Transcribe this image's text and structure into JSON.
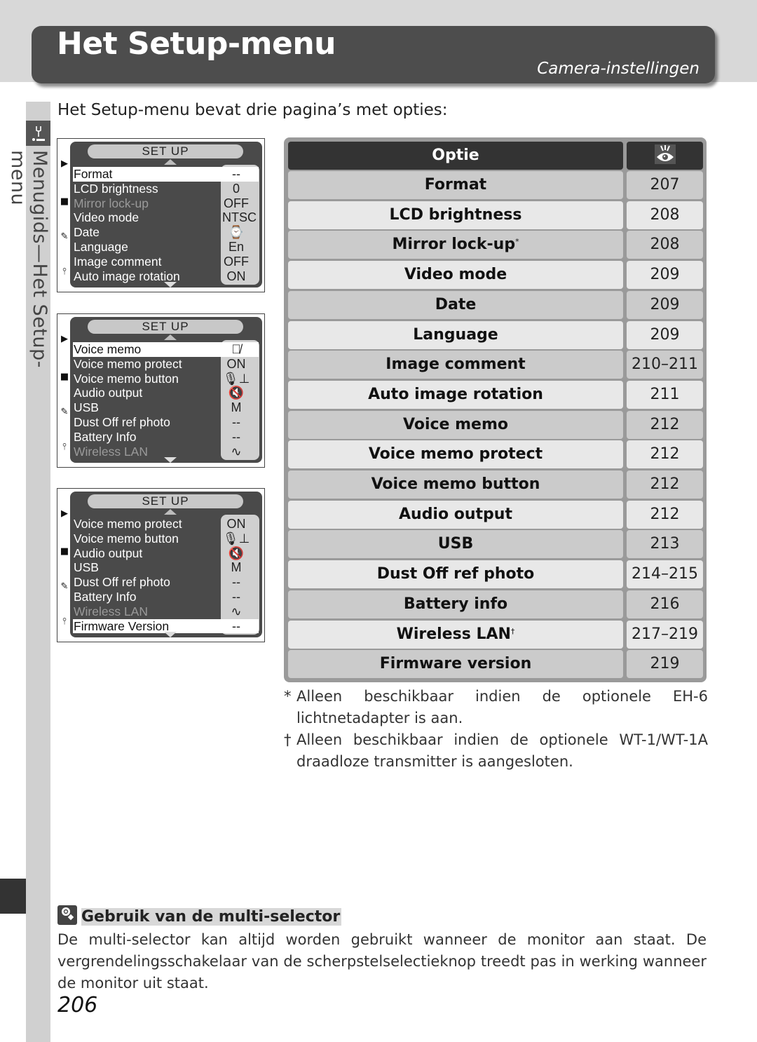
{
  "header": {
    "title": "Het Setup-menu",
    "subtitle": "Camera-instellingen"
  },
  "side_tab": {
    "icon": "wrench-icon",
    "label": "Menugids—Het Setup-menu"
  },
  "intro": "Het Setup-menu bevat drie pagina’s met opties:",
  "lcd_screens": [
    {
      "header": "SET UP",
      "rows": [
        {
          "label": "Format",
          "value": "--",
          "selected": true,
          "dimmed": false
        },
        {
          "label": "LCD brightness",
          "value": "0",
          "selected": false,
          "dimmed": false
        },
        {
          "label": "Mirror lock-up",
          "value": "OFF",
          "selected": false,
          "dimmed": true
        },
        {
          "label": "Video mode",
          "value": "NTSC",
          "selected": false,
          "dimmed": false
        },
        {
          "label": "Date",
          "value": "⌚",
          "selected": false,
          "dimmed": false
        },
        {
          "label": "Language",
          "value": "En",
          "selected": false,
          "dimmed": false
        },
        {
          "label": "Image comment",
          "value": "OFF",
          "selected": false,
          "dimmed": false
        },
        {
          "label": "Auto image rotation",
          "value": "ON",
          "selected": false,
          "dimmed": false
        }
      ]
    },
    {
      "header": "SET UP",
      "rows": [
        {
          "label": "Voice memo",
          "value": "🎙̸",
          "selected": true,
          "dimmed": false
        },
        {
          "label": "Voice memo protect",
          "value": "ON",
          "selected": false,
          "dimmed": false
        },
        {
          "label": "Voice memo button",
          "value": "🎙⊥",
          "selected": false,
          "dimmed": false
        },
        {
          "label": "Audio output",
          "value": "🔇",
          "selected": false,
          "dimmed": false
        },
        {
          "label": "USB",
          "value": "M",
          "selected": false,
          "dimmed": false
        },
        {
          "label": "Dust Off ref photo",
          "value": "--",
          "selected": false,
          "dimmed": false
        },
        {
          "label": "Battery Info",
          "value": "--",
          "selected": false,
          "dimmed": false
        },
        {
          "label": "Wireless LAN",
          "value": "∿",
          "selected": false,
          "dimmed": true
        }
      ]
    },
    {
      "header": "SET UP",
      "rows": [
        {
          "label": "Voice memo protect",
          "value": "ON",
          "selected": false,
          "dimmed": false
        },
        {
          "label": "Voice memo button",
          "value": "🎙⊥",
          "selected": false,
          "dimmed": false
        },
        {
          "label": "Audio output",
          "value": "🔇",
          "selected": false,
          "dimmed": false
        },
        {
          "label": "USB",
          "value": "M",
          "selected": false,
          "dimmed": false
        },
        {
          "label": "Dust Off ref photo",
          "value": "--",
          "selected": false,
          "dimmed": false
        },
        {
          "label": "Battery Info",
          "value": "--",
          "selected": false,
          "dimmed": false
        },
        {
          "label": "Wireless LAN",
          "value": "∿",
          "selected": false,
          "dimmed": true
        },
        {
          "label": "Firmware Version",
          "value": "--",
          "selected": true,
          "dimmed": false
        }
      ]
    }
  ],
  "lcd_tabs": [
    "playback-icon",
    "camera-icon",
    "pencil-icon",
    "wrench-icon"
  ],
  "table": {
    "header_option": "Optie",
    "header_page_icon": "page-reference-eye-icon",
    "rows": [
      {
        "option": "Format",
        "mark": "",
        "page": "207"
      },
      {
        "option": "LCD brightness",
        "mark": "",
        "page": "208"
      },
      {
        "option": "Mirror lock-up",
        "mark": "*",
        "page": "208"
      },
      {
        "option": "Video mode",
        "mark": "",
        "page": "209"
      },
      {
        "option": "Date",
        "mark": "",
        "page": "209"
      },
      {
        "option": "Language",
        "mark": "",
        "page": "209"
      },
      {
        "option": "Image comment",
        "mark": "",
        "page": "210–211"
      },
      {
        "option": "Auto image rotation",
        "mark": "",
        "page": "211"
      },
      {
        "option": "Voice memo",
        "mark": "",
        "page": "212"
      },
      {
        "option": "Voice memo protect",
        "mark": "",
        "page": "212"
      },
      {
        "option": "Voice memo button",
        "mark": "",
        "page": "212"
      },
      {
        "option": "Audio output",
        "mark": "",
        "page": "212"
      },
      {
        "option": "USB",
        "mark": "",
        "page": "213"
      },
      {
        "option": "Dust Off ref photo",
        "mark": "",
        "page": "214–215"
      },
      {
        "option": "Battery info",
        "mark": "",
        "page": "216"
      },
      {
        "option": "Wireless LAN",
        "mark": "†",
        "page": "217–219"
      },
      {
        "option": "Firmware version",
        "mark": "",
        "page": "219"
      }
    ]
  },
  "footnotes": [
    {
      "mark": "*",
      "text": "Alleen beschikbaar indien de optionele EH-6 lichtnetadapter is aan."
    },
    {
      "mark": "†",
      "text": "Alleen beschikbaar indien de optionele WT-1/WT-1A draadloze transmitter is aangesloten."
    }
  ],
  "tip": {
    "icon": "tip-magnifier-icon",
    "title": "Gebruik van de multi-selector",
    "body": "De multi-selector kan altijd worden gebruikt wanneer de monitor aan staat. De vergrendelingsschakelaar van de scherpstelselectieknop treedt pas in werking wanneer de monitor uit staat."
  },
  "page_number": "206"
}
